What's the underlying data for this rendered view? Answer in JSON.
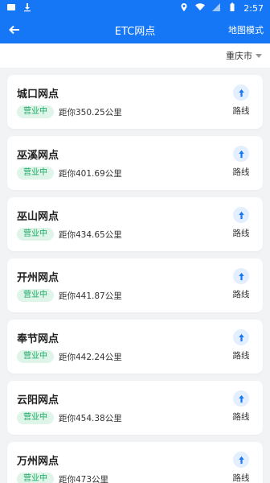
{
  "statusbar": {
    "time": "2:57"
  },
  "header": {
    "title": "ETC网点",
    "map_mode": "地图模式"
  },
  "filter": {
    "city": "重庆市"
  },
  "status_label": "营业中",
  "route_label": "路线",
  "outlets": [
    {
      "name": "城口网点",
      "distance": "距你350.25公里"
    },
    {
      "name": "巫溪网点",
      "distance": "距你401.69公里"
    },
    {
      "name": "巫山网点",
      "distance": "距你434.65公里"
    },
    {
      "name": "开州网点",
      "distance": "距你441.87公里"
    },
    {
      "name": "奉节网点",
      "distance": "距你442.24公里"
    },
    {
      "name": "云阳网点",
      "distance": "距你454.38公里"
    },
    {
      "name": "万州网点",
      "distance": "距你473公里"
    }
  ],
  "colors": {
    "primary": "#1677f6",
    "status_green": "#1aa863",
    "status_bg": "#dff5e9"
  }
}
